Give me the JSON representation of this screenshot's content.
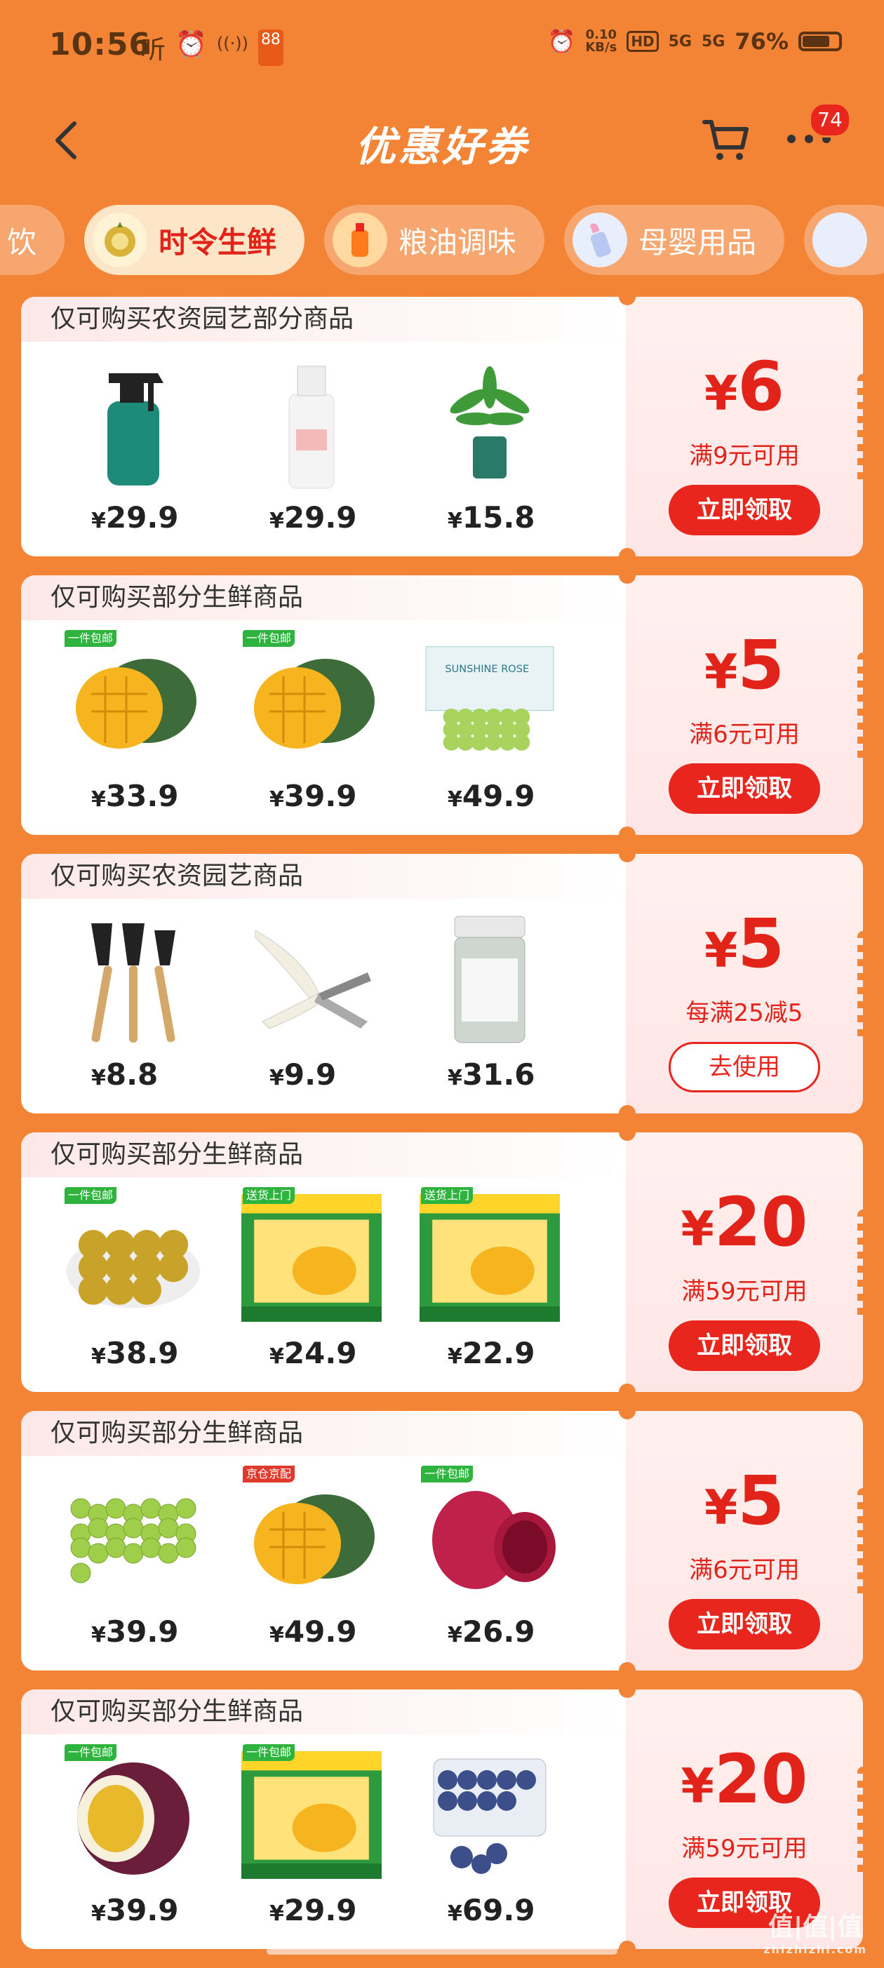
{
  "status": {
    "time": "10:56",
    "left_icons": [
      "听",
      "⏰",
      "((·))",
      "88"
    ],
    "netspeed_value": "0.10",
    "netspeed_unit": "KB/s",
    "network1": "HD",
    "network2": "5G",
    "network3": "5G",
    "battery": "76%"
  },
  "nav": {
    "title": "优惠好券",
    "cart_badge": "74"
  },
  "tabs": [
    {
      "label": "饮",
      "active": false
    },
    {
      "label": "时令生鲜",
      "active": true
    },
    {
      "label": "粮油调味",
      "active": false
    },
    {
      "label": "母婴用品",
      "active": false
    }
  ],
  "colors": {
    "background": "#F38436",
    "accent": "#E8261D",
    "tag_green": "#2EB43E"
  },
  "coupons": [
    {
      "title": "仅可购买农资园艺部分商品",
      "amount": "6",
      "currency": "¥",
      "condition": "满9元可用",
      "button": "立即领取",
      "button_style": "filled",
      "products": [
        {
          "icon": "spray-bottle",
          "price": "29.9",
          "tag": ""
        },
        {
          "icon": "lotion-bottle",
          "price": "29.9",
          "tag": ""
        },
        {
          "icon": "potted-plant",
          "price": "15.8",
          "tag": ""
        }
      ]
    },
    {
      "title": "仅可购买部分生鲜商品",
      "amount": "5",
      "currency": "¥",
      "condition": "满6元可用",
      "button": "立即领取",
      "button_style": "filled",
      "products": [
        {
          "icon": "mango",
          "price": "33.9",
          "tag": "一件包邮"
        },
        {
          "icon": "mango",
          "price": "39.9",
          "tag": "一件包邮"
        },
        {
          "icon": "grapes-box",
          "price": "49.9",
          "tag": ""
        }
      ]
    },
    {
      "title": "仅可购买农资园艺商品",
      "amount": "5",
      "currency": "¥",
      "condition": "每满25减5",
      "button": "去使用",
      "button_style": "outline",
      "products": [
        {
          "icon": "garden-tools",
          "price": "8.8",
          "tag": ""
        },
        {
          "icon": "pruning-shears",
          "price": "9.9",
          "tag": ""
        },
        {
          "icon": "pill-jar",
          "price": "31.6",
          "tag": ""
        }
      ]
    },
    {
      "title": "仅可购买部分生鲜商品",
      "amount": "20",
      "currency": "¥",
      "condition": "满59元可用",
      "button": "立即领取",
      "button_style": "filled",
      "products": [
        {
          "icon": "longan-plate",
          "price": "38.9",
          "tag": "一件包邮"
        },
        {
          "icon": "mango-box",
          "price": "24.9",
          "tag": "送货上门"
        },
        {
          "icon": "mango-box",
          "price": "22.9",
          "tag": "送货上门"
        }
      ]
    },
    {
      "title": "仅可购买部分生鲜商品",
      "amount": "5",
      "currency": "¥",
      "condition": "满6元可用",
      "button": "立即领取",
      "button_style": "filled",
      "products": [
        {
          "icon": "green-grapes",
          "price": "39.9",
          "tag": ""
        },
        {
          "icon": "mango",
          "price": "49.9",
          "tag": "京仓京配"
        },
        {
          "icon": "dragon-fruit",
          "price": "26.9",
          "tag": "一件包邮"
        }
      ]
    },
    {
      "title": "仅可购买部分生鲜商品",
      "amount": "20",
      "currency": "¥",
      "condition": "满59元可用",
      "button": "立即领取",
      "button_style": "filled",
      "products": [
        {
          "icon": "passion-fruit",
          "price": "39.9",
          "tag": "一件包邮"
        },
        {
          "icon": "mango-box",
          "price": "29.9",
          "tag": "一件包邮"
        },
        {
          "icon": "blueberries",
          "price": "69.9",
          "tag": ""
        }
      ]
    }
  ],
  "watermark": {
    "text": "值|值|值",
    "sub": "zhizhizhi.com"
  }
}
